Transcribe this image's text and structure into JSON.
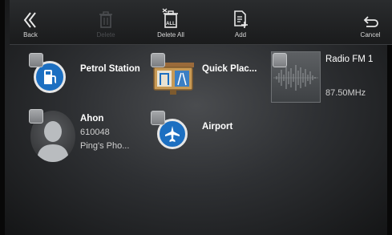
{
  "toolbar": {
    "back_label": "Back",
    "delete_label": "Delete",
    "delete_all_label": "Delete All",
    "add_label": "Add",
    "cancel_label": "Cancel"
  },
  "favorites": [
    {
      "title": "Petrol Station",
      "icon": "fuel-pump-icon"
    },
    {
      "title": "Quick Plac...",
      "icon": "quick-place-icon"
    },
    {
      "title": "Radio FM 1",
      "subtitle": "87.50MHz",
      "icon": "radio-waveform-icon"
    },
    {
      "title": "Ahon",
      "line2": "610048",
      "line3": "Ping's Pho...",
      "icon": "person-silhouette-icon"
    },
    {
      "title": "Airport",
      "icon": "airplane-icon"
    }
  ],
  "colors": {
    "accent_blue": "#1c6fc1",
    "checkbox_gray": "#8e9093"
  }
}
